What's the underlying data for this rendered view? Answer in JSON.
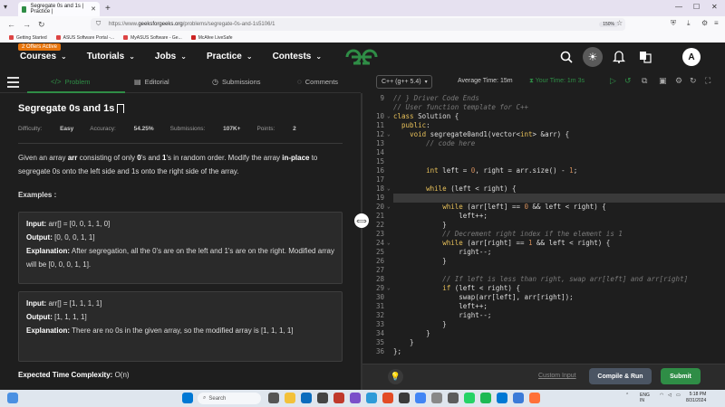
{
  "browser": {
    "tab_title": "Segregate 0s and 1s | Practice |",
    "url_prefix": "https://www.",
    "url_host": "geeksforgeeks.org",
    "url_path": "/problems/segregate-0s-and-1s5106/1",
    "zoom": "150%",
    "bookmarks": [
      "Getting Started",
      "ASUS Software Portal -...",
      "MyASUS Software - Ge...",
      "McAfee LiveSafe"
    ]
  },
  "site_nav": {
    "offer_badge": "2 Offers Active",
    "links": [
      "Courses",
      "Tutorials",
      "Jobs",
      "Practice",
      "Contests"
    ],
    "avatar_letter": "A"
  },
  "problem_tabs": {
    "problem": "Problem",
    "editorial": "Editorial",
    "submissions": "Submissions",
    "comments": "Comments"
  },
  "problem": {
    "title": "Segregate 0s and 1s",
    "difficulty_label": "Difficulty:",
    "difficulty": "Easy",
    "accuracy_label": "Accuracy:",
    "accuracy": "54.25%",
    "submissions_label": "Submissions:",
    "submissions": "107K+",
    "points_label": "Points:",
    "points": "2",
    "desc_1": "Given an array ",
    "desc_arr": "arr",
    "desc_2": " consisting of only ",
    "desc_0": "0",
    "desc_3": "'s and ",
    "desc_1b": "1",
    "desc_4": "'s in random order. Modify the array ",
    "desc_inplace": "in-place",
    "desc_5": " to segregate 0s onto the left side and 1s onto the right side of the array.",
    "examples_heading": "Examples :",
    "input_label": "Input:",
    "output_label": "Output:",
    "explanation_label": "Explanation:",
    "ex1_input": "arr[] = [0, 0, 1, 1, 0]",
    "ex1_output": "[0, 0, 0, 1, 1]",
    "ex1_explanation": "After segregation, all the 0's are on the left and 1's are on the right. Modified array will be [0, 0, 0, 1, 1].",
    "ex2_input": "arr[] = [1, 1, 1, 1]",
    "ex2_output": "[1, 1, 1, 1]",
    "ex2_explanation": "There are no 0s in the given array, so the modified array is [1, 1, 1, 1]",
    "time_complexity_label": "Expected Time Complexity:",
    "time_complexity": "O(n)"
  },
  "editor_toolbar": {
    "language": "C++ (g++ 5.4)",
    "avg_time_label": "Average Time:",
    "avg_time": "15m",
    "your_time_label": "Your Time:",
    "your_time": "1m 3s"
  },
  "code_lines": [
    {
      "n": "9",
      "t": "// } Driver Code Ends",
      "c": "cm"
    },
    {
      "n": "",
      "t": "// User function template for C++",
      "c": "cm"
    },
    {
      "n": "10",
      "t": "class Solution {",
      "c": ""
    },
    {
      "n": "11",
      "t": "  public:",
      "c": ""
    },
    {
      "n": "12",
      "t": "    void segregate0and1(vector<int> &arr) {",
      "c": ""
    },
    {
      "n": "13",
      "t": "        // code here",
      "c": "cm"
    },
    {
      "n": "14",
      "t": "",
      "c": ""
    },
    {
      "n": "15",
      "t": "",
      "c": ""
    },
    {
      "n": "16",
      "t": "        int left = 0, right = arr.size() - 1;",
      "c": ""
    },
    {
      "n": "17",
      "t": "",
      "c": ""
    },
    {
      "n": "18",
      "t": "        while (left < right) {",
      "c": ""
    },
    {
      "n": "19",
      "t": "",
      "c": ""
    },
    {
      "n": "20",
      "t": "            while (arr[left] == 0 && left < right) {",
      "c": ""
    },
    {
      "n": "21",
      "t": "                left++;",
      "c": ""
    },
    {
      "n": "22",
      "t": "            }",
      "c": ""
    },
    {
      "n": "23",
      "t": "            // Decrement right index if the element is 1",
      "c": "cm"
    },
    {
      "n": "24",
      "t": "            while (arr[right] == 1 && left < right) {",
      "c": ""
    },
    {
      "n": "25",
      "t": "                right--;",
      "c": ""
    },
    {
      "n": "26",
      "t": "            }",
      "c": ""
    },
    {
      "n": "27",
      "t": "",
      "c": ""
    },
    {
      "n": "28",
      "t": "            // If left is less than right, swap arr[left] and arr[right]",
      "c": "cm"
    },
    {
      "n": "29",
      "t": "            if (left < right) {",
      "c": ""
    },
    {
      "n": "30",
      "t": "                swap(arr[left], arr[right]);",
      "c": ""
    },
    {
      "n": "31",
      "t": "                left++;",
      "c": ""
    },
    {
      "n": "32",
      "t": "                right--;",
      "c": ""
    },
    {
      "n": "33",
      "t": "            }",
      "c": ""
    },
    {
      "n": "34",
      "t": "        }",
      "c": ""
    },
    {
      "n": "35",
      "t": "    }",
      "c": ""
    },
    {
      "n": "36",
      "t": "};",
      "c": ""
    }
  ],
  "bottom_bar": {
    "custom_input": "Custom Input",
    "compile_run": "Compile & Run",
    "submit": "Submit"
  },
  "taskbar": {
    "search_placeholder": "Search",
    "lang": "ENG",
    "region": "IN",
    "time": "5:18 PM",
    "date": "8/31/2024"
  },
  "colors": {
    "brand_green": "#2f8d46",
    "background": "#1e1e1e"
  }
}
